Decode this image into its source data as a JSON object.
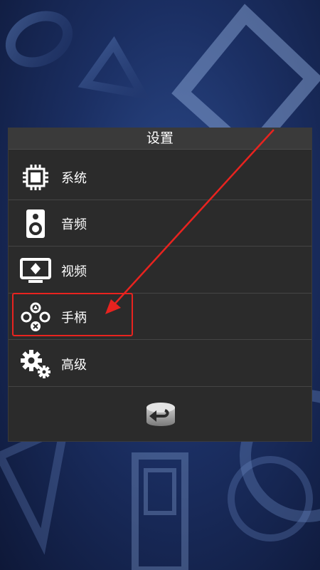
{
  "dialog": {
    "title": "设置",
    "items": [
      {
        "label": "系统",
        "icon": "cpu-chip-icon"
      },
      {
        "label": "音频",
        "icon": "speaker-icon"
      },
      {
        "label": "视频",
        "icon": "monitor-icon"
      },
      {
        "label": "手柄",
        "icon": "gamepad-buttons-icon"
      },
      {
        "label": "高级",
        "icon": "gears-icon"
      }
    ],
    "back_icon": "back-arrow-icon"
  },
  "annotation": {
    "color": "#e8231f",
    "target": "手柄"
  }
}
